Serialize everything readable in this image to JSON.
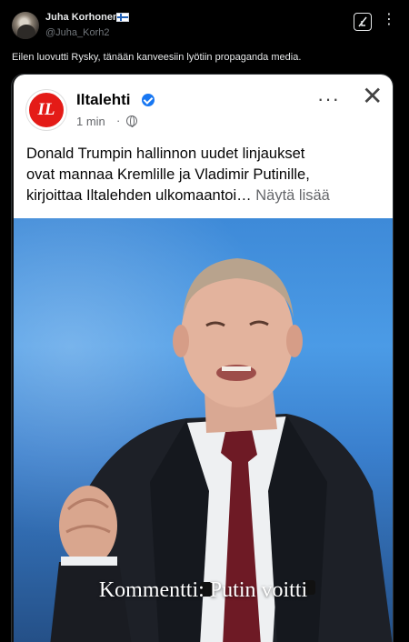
{
  "tweet": {
    "author_name": "Juha Korhonen",
    "author_handle": "@Juha_Korh2",
    "flag_icon": "finland-flag-icon",
    "text": "Eilen luovutti Rysky, tänään kanveesiin lyötiin propaganda media."
  },
  "card": {
    "source_name": "Iltalehti",
    "logo_text": "IL",
    "logo_color": "#e41b17",
    "time": "1 min",
    "time_separator": "·",
    "menu_label": "···",
    "close_label": "✕",
    "post_lines": [
      "Donald Trumpin hallinnon uudet linjaukset",
      "ovat mannaa Kremlille ja Vladimir Putinille,",
      "kirjoittaa Iltalehden ulkomaantoi…"
    ],
    "see_more": "Näytä lisää",
    "image_caption": "Kommentti: Putin voitti"
  },
  "colors": {
    "background": "#000000",
    "verified": "#1877f2",
    "photo_background": "#4b9be6"
  }
}
